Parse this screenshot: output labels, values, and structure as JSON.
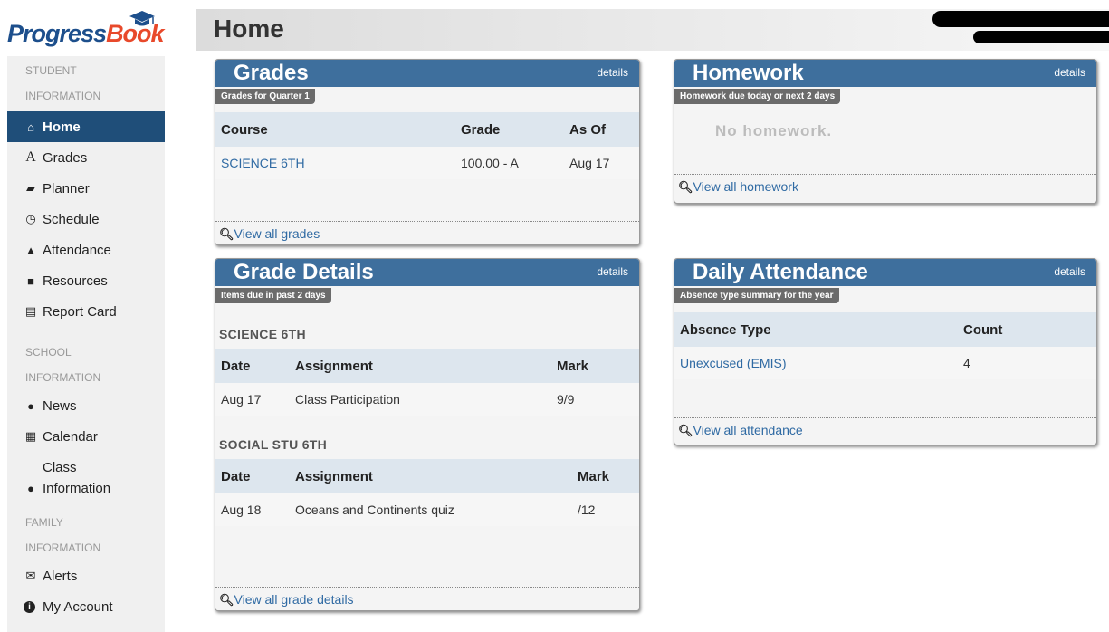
{
  "logo": {
    "part1": "Progress",
    "part2": "Book"
  },
  "header": {
    "title": "Home"
  },
  "sidebar": {
    "student_section": [
      "STUDENT",
      "INFORMATION"
    ],
    "student_items": [
      {
        "label": "Home",
        "icon": "home-icon",
        "glyph": "⌂"
      },
      {
        "label": "Grades",
        "icon": "grades-icon",
        "glyph": "A"
      },
      {
        "label": "Planner",
        "icon": "planner-icon",
        "glyph": "▰"
      },
      {
        "label": "Schedule",
        "icon": "clock-icon",
        "glyph": "◷"
      },
      {
        "label": "Attendance",
        "icon": "bell-icon",
        "glyph": "▲"
      },
      {
        "label": "Resources",
        "icon": "file-icon",
        "glyph": "■"
      },
      {
        "label": "Report Card",
        "icon": "card-icon",
        "glyph": "▤"
      }
    ],
    "school_section": [
      "SCHOOL",
      "INFORMATION"
    ],
    "school_items": [
      {
        "label": "News",
        "icon": "globe-icon",
        "glyph": "●"
      },
      {
        "label": "Calendar",
        "icon": "calendar-icon",
        "glyph": "▦"
      },
      {
        "label": "Class Information",
        "icon": "comment-icon",
        "glyph": "●"
      }
    ],
    "family_section": [
      "FAMILY",
      "INFORMATION"
    ],
    "family_items": [
      {
        "label": "Alerts",
        "icon": "envelope-icon",
        "glyph": "✉"
      },
      {
        "label": "My Account",
        "icon": "info-icon",
        "glyph": "i"
      }
    ]
  },
  "grades": {
    "title": "Grades",
    "details": "details",
    "tag": "Grades for Quarter 1",
    "columns": [
      "Course",
      "Grade",
      "As Of"
    ],
    "rows": [
      {
        "course": "SCIENCE 6TH",
        "grade": "100.00 - A",
        "as_of": "Aug 17"
      }
    ],
    "footer": "View all grades"
  },
  "homework": {
    "title": "Homework",
    "details": "details",
    "tag": "Homework due today or next 2 days",
    "empty": "No homework.",
    "footer": "View all homework"
  },
  "grade_details": {
    "title": "Grade Details",
    "details": "details",
    "tag": "Items due in past 2 days",
    "columns": [
      "Date",
      "Assignment",
      "Mark"
    ],
    "courses": [
      {
        "name": "SCIENCE 6TH",
        "rows": [
          {
            "date": "Aug 17",
            "assignment": "Class Participation",
            "mark": "9/9"
          }
        ]
      },
      {
        "name": "SOCIAL STU 6TH",
        "rows": [
          {
            "date": "Aug 18",
            "assignment": "Oceans and Continents quiz",
            "mark": "/12"
          }
        ]
      }
    ],
    "footer": "View all grade details"
  },
  "attendance": {
    "title": "Daily Attendance",
    "details": "details",
    "tag": "Absence type summary for the year",
    "columns": [
      "Absence Type",
      "Count"
    ],
    "rows": [
      {
        "type": "Unexcused (EMIS)",
        "count": "4"
      }
    ],
    "footer": "View all attendance"
  },
  "colors": {
    "nav_active": "#1f4e79",
    "widget_header": "#3e6f9d",
    "link": "#2f6aa3"
  }
}
